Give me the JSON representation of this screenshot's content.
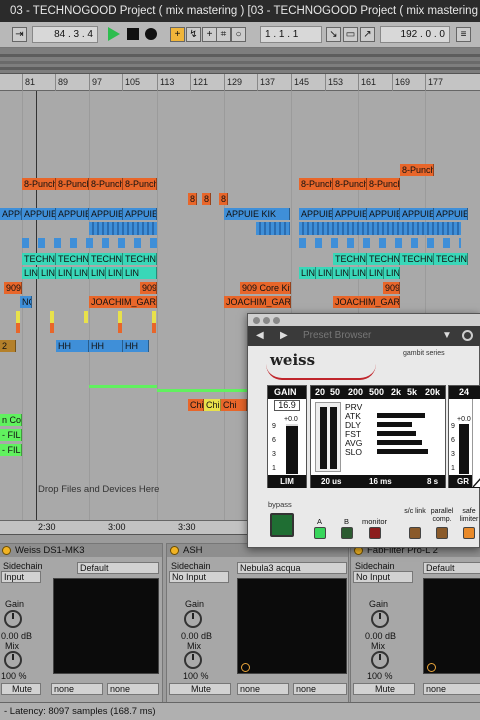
{
  "window": {
    "title": "03 - TECHNOGOOD Project ( mix mastering )  [03 - TECHNOGOOD Project ( mix mastering )]"
  },
  "transport": {
    "position": "84 .  3 .  4",
    "loop_start": "1 .  1 .  1",
    "loop_length": "192 .  0 .  0"
  },
  "ruler": {
    "bars": [
      "81",
      "89",
      "97",
      "105",
      "113",
      "121",
      "129",
      "137",
      "145",
      "153",
      "161",
      "169",
      "177"
    ]
  },
  "timeline": {
    "times": [
      "2:30",
      "3:00",
      "3:30"
    ]
  },
  "arrangement": {
    "drop_hint": "Drop Files and Devices Here",
    "clips": {
      "punch_top": "8-Punch",
      "punch": [
        "8-Punch",
        "8-Punch",
        "8-Punch"
      ],
      "punch_r": [
        "8-Punch",
        "8-Punch",
        "8-Punch"
      ],
      "eights": [
        "8",
        "8",
        "8"
      ],
      "appuie": [
        "APPUIE K",
        "APPUIE K",
        "APPUIE K",
        "APPUIE K"
      ],
      "appuie_mid": "APPUIE KIK",
      "appuie_r": [
        "APPUIE K",
        "APPUIE K",
        "APPUIE K",
        "APPUIE K",
        "APPUIE K"
      ],
      "techno": [
        "TECHNO",
        "TECHNO",
        "TECHNO",
        "TECHNO"
      ],
      "techno_r": [
        "TECHNO",
        "TECHNO",
        "TECHNO",
        "TECHNO"
      ],
      "lin": [
        "LIN",
        "LIN",
        "LIN",
        "LIN",
        "LIN",
        "LIN",
        "LIN"
      ],
      "lin_r": [
        "LIN",
        "LIN",
        "LIN",
        "LIN",
        "LIN",
        "LIN"
      ],
      "kit909": [
        "909",
        "909",
        "909 Core Kit",
        "909"
      ],
      "joachim": [
        "JOACHIM_GARRA",
        "JOACHIM_GARRA",
        "JOACHIM_GARRA"
      ],
      "hh": [
        "HH",
        "HH",
        "HH"
      ],
      "chi": [
        "Chi",
        "Chi",
        "Chi"
      ],
      "nc": "NC",
      "co": "n Co",
      "fil": [
        "- FIL",
        "- FIL"
      ],
      "two": "2"
    }
  },
  "plugin": {
    "nav_title": "Preset Browser",
    "brand": "weiss",
    "series": "gambit series",
    "gain": {
      "label": "GAIN",
      "value": "16.9",
      "top": "+0.0",
      "scale": [
        "9",
        "6",
        "3",
        "1"
      ],
      "foot": "LIM"
    },
    "freqs": [
      "20",
      "50",
      "200",
      "500",
      "2k",
      "5k",
      "20k"
    ],
    "params": [
      "PRV",
      "ATK",
      "DLY",
      "FST",
      "AVG",
      "SLO"
    ],
    "param_levels": [
      0,
      0.82,
      0.6,
      0.68,
      0.78,
      0.88
    ],
    "times": [
      "20 us",
      "16 ms",
      "8 s"
    ],
    "right": {
      "value": "24",
      "top": "+0.0",
      "scale": [
        "9",
        "6",
        "3",
        "1"
      ],
      "foot": "GR"
    },
    "controls": {
      "bypass": "bypass",
      "a": "A",
      "b": "B",
      "monitor": "monitor",
      "sc_link": "s/c link",
      "parallel": "parallel comp.",
      "safe": "safe limiter"
    }
  },
  "devices": [
    {
      "name": "Weiss DS1-MK3",
      "sidechain": "Sidechain",
      "input": "Input",
      "preset": "Default",
      "gain": "Gain",
      "gain_val": "0.00 dB",
      "mix": "Mix",
      "mix_val": "100 %",
      "mute": "Mute",
      "none1": "none",
      "none2": "none"
    },
    {
      "name": "ASH",
      "sidechain": "Sidechain",
      "input": "No Input",
      "preset": "Nebula3 acqua",
      "gain": "Gain",
      "gain_val": "0.00 dB",
      "mix": "Mix",
      "mix_val": "100 %",
      "mute": "Mute",
      "none1": "none",
      "none2": "none"
    },
    {
      "name": "FabFilter Pro-L 2",
      "sidechain": "Sidechain",
      "input": "No Input",
      "preset": "Default",
      "gain": "Gain",
      "gain_val": "0.00 dB",
      "mix": "Mix",
      "mix_val": "100 %",
      "mute": "Mute",
      "none1": "none"
    }
  ],
  "status": {
    "latency": "- Latency: 8097 samples (168.7 ms)"
  },
  "colors": {
    "orange": "#e8662a",
    "blue": "#3f8fd8",
    "teal": "#39d7b8",
    "green": "#61f15f",
    "play": "#2dbd4e"
  }
}
